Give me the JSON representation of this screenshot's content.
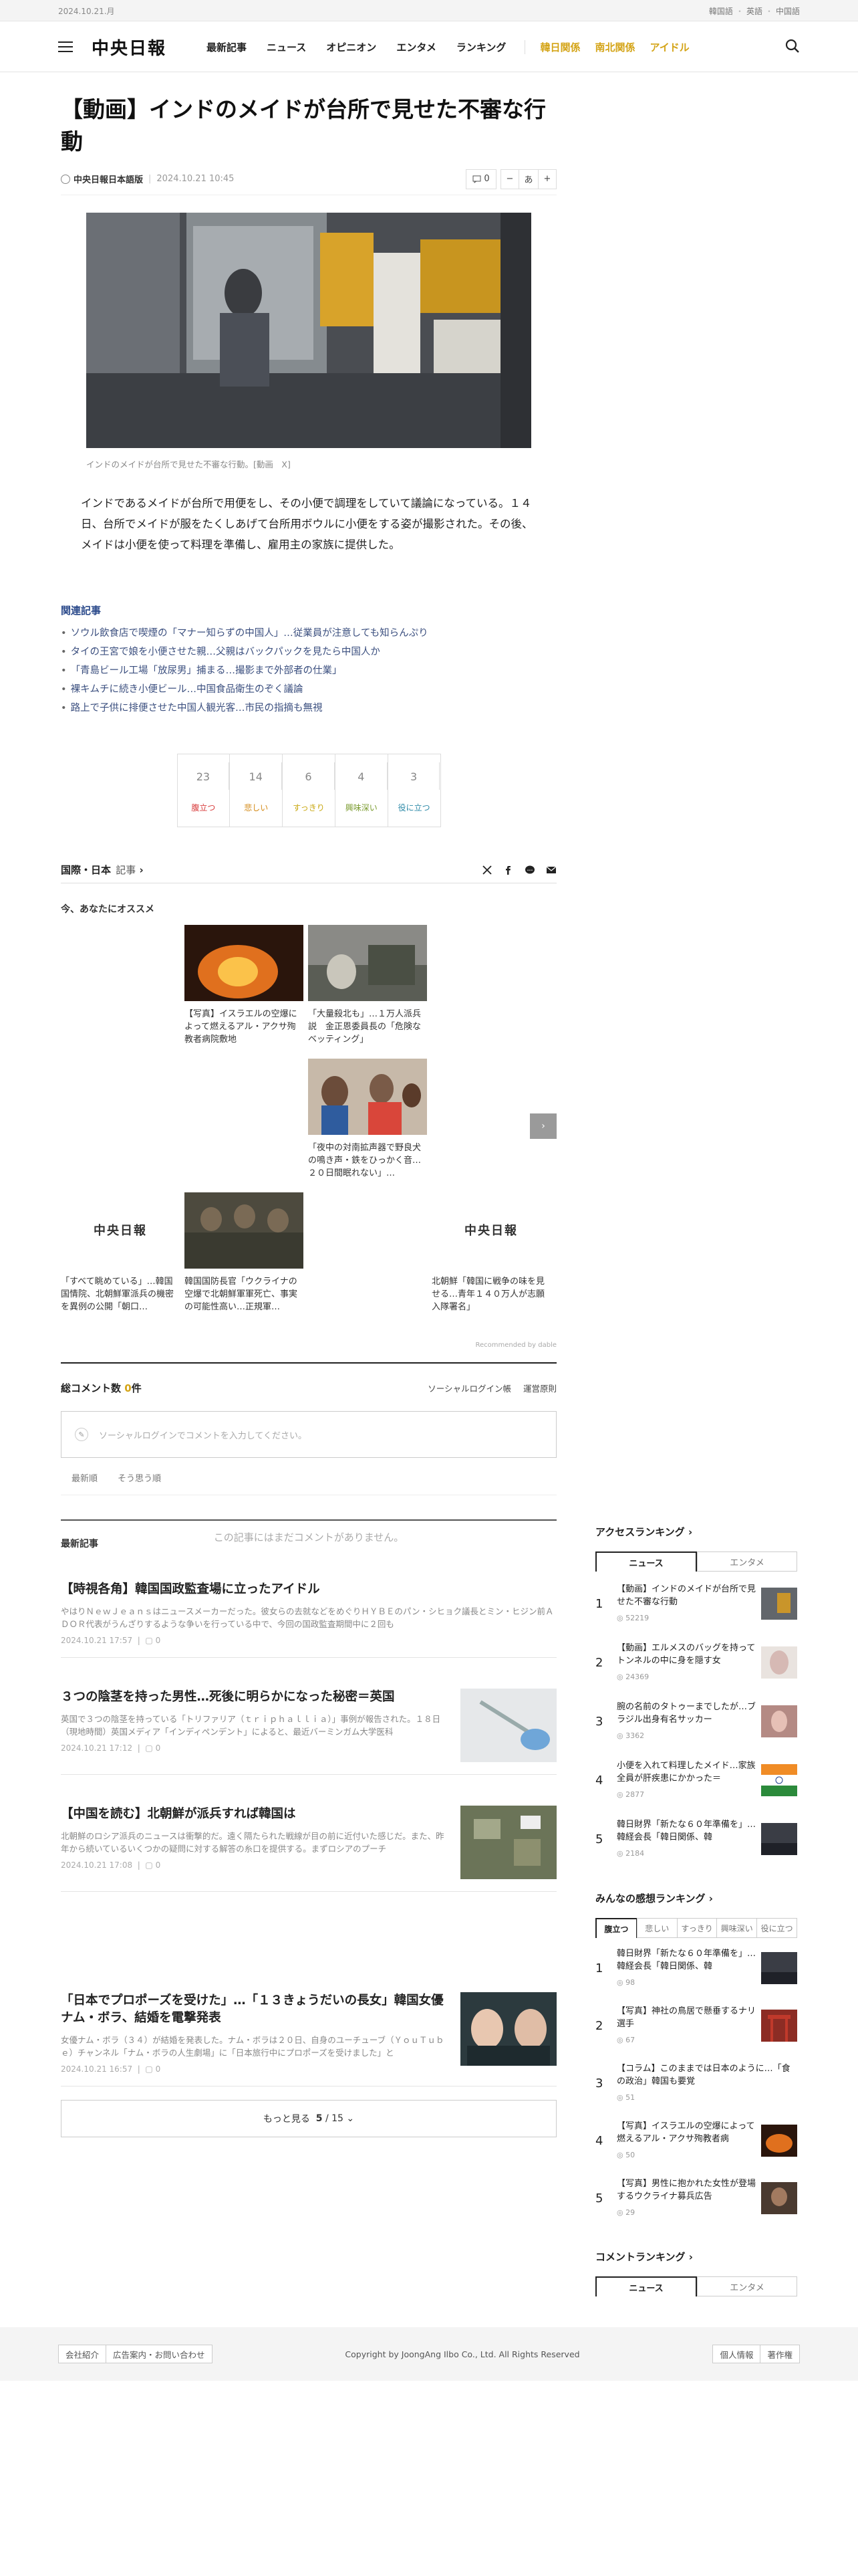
{
  "topbar": {
    "date": "2024.10.21.月",
    "languages": [
      "韓国語",
      "英語",
      "中国語"
    ]
  },
  "header": {
    "logo": "中央日報",
    "nav": [
      "最新記事",
      "ニュース",
      "オピニオン",
      "エンタメ",
      "ランキング"
    ],
    "subnav": [
      "韓日関係",
      "南北関係",
      "アイドル"
    ]
  },
  "article": {
    "title": "【動画】インドのメイドが台所で見せた不審な行動",
    "source": "中央日報日本語版",
    "datetime": "2024.10.21 10:45",
    "comment_count": "0",
    "font_label": "あ",
    "caption": "インドのメイドが台所で見せた不審な行動。[動画　X]",
    "body": "インドであるメイドが台所で用便をし、その小便で調理をしていて議論になっている。１４日、台所でメイドが服をたくしあげて台所用ボウルに小便をする姿が撮影された。その後、メイドは小便を使って料理を準備し、雇用主の家族に提供した。"
  },
  "related": {
    "heading": "関連記事",
    "items": [
      "ソウル飲食店で喫煙の「マナー知らずの中国人」…従業員が注意しても知らんぷり",
      "タイの王宮で娘を小便させた親…父親はバックパックを見たら中国人か",
      "「青島ビール工場「放尿男」捕まる…撮影まで外部者の仕業」",
      "裸キムチに続き小便ビール…中国食品衛生のぞく議論",
      "路上で子供に排便させた中国人観光客…市民の指摘も無視"
    ]
  },
  "reactions": [
    {
      "count": "23",
      "label": "腹立つ",
      "color": "#d83b3b"
    },
    {
      "count": "14",
      "label": "悲しい",
      "color": "#d48a17"
    },
    {
      "count": "6",
      "label": "すっきり",
      "color": "#d4b417"
    },
    {
      "count": "4",
      "label": "興味深い",
      "color": "#7a9b2e"
    },
    {
      "count": "3",
      "label": "役に立つ",
      "color": "#2e8aa8"
    }
  ],
  "section": {
    "name": "国際・日本",
    "suffix": "記事"
  },
  "recommend": {
    "heading": "今、あなたにオススメ",
    "items": [
      "【写真】イスラエルの空爆によって燃えるアル・アクサ殉教者病院敷地",
      "「大量殺北も」…１万人派兵説　金正恩委員長の「危険なベッティング」",
      "「夜中の対南拡声器で野良犬の鳴き声・鉄をひっかく音…２０日間眠れない」…",
      "「すべて眺めている」…韓国国情院、北朝鮮軍派兵の機密を異例の公開「朝口…",
      "韓国国防長官「ウクライナの空爆で北朝鮮軍軍死亡、事実の可能性高い…正規軍…",
      "北朝鮮「韓国に戦争の味を見せる…青年１４０万人が志願入隊署名」"
    ],
    "logo_text": "中央日報",
    "powered": "Recommended by dable"
  },
  "comments": {
    "label": "総コメント数",
    "count": "0",
    "unit": "件",
    "login": "ソーシャルログイン帳",
    "rules": "運営原則",
    "placeholder": "ソーシャルログインでコメントを入力してください。",
    "sort": [
      "最新順",
      "そう思う順"
    ],
    "empty": "この記事にはまだコメントがありません。"
  },
  "latest": {
    "heading": "最新記事",
    "items": [
      {
        "title": "【時視各角】韓国国政監査場に立ったアイドル",
        "summary": "やはりＮｅｗＪｅａｎｓはニュースメーカーだった。彼女らの去就などをめぐりＨＹＢＥのパン・シヒョク議長とミン・ヒジン前ＡＤＯＲ代表がうんざりするような争いを行っている中で、今回の国政監査期間中に２回も",
        "date": "2024.10.21 17:57",
        "comments": "0"
      },
      {
        "title": "３つの陰茎を持った男性…死後に明らかになった秘密＝英国",
        "summary": "英国で３つの陰茎を持っている「トリファリア（ｔｒｉｐｈａｌｌｉａ）」事例が報告された。１８日（現地時間）英国メディア「インディペンデント」によると、最近バーミンガム大学医科",
        "date": "2024.10.21 17:12",
        "comments": "0"
      },
      {
        "title": "【中国を読む】北朝鮮が派兵すれば韓国は",
        "summary": "北朝鮮のロシア派兵のニュースは衝撃的だ。遠く隔たられた戦線が目の前に近付いた感じだ。また、昨年から続いているいくつかの疑問に対する解答の糸口を提供する。まずロシアのプーチ",
        "date": "2024.10.21 17:08",
        "comments": "0"
      },
      {
        "title": "「日本でプロポーズを受けた」…「１３きょうだいの長女」韓国女優ナム・ボラ、結婚を電撃発表",
        "summary": "女優ナム・ボラ（３４）が結婚を発表した。ナム・ボラは２０日、自身のユーチューブ（ＹｏｕＴｕｂｅ）チャンネル「ナム・ボラの人生劇場」に「日本旅行中にプロポーズを受けました」と",
        "date": "2024.10.21 16:57",
        "comments": "0"
      }
    ],
    "more": "もっと見る",
    "page": "5",
    "pages": "15"
  },
  "sidebar": {
    "access_heading": "アクセスランキング",
    "access_tabs": [
      "ニュース",
      "エンタメ"
    ],
    "access": [
      {
        "title": "【動画】インドのメイドが台所で見せた不審な行動",
        "views": "52219"
      },
      {
        "title": "【動画】エルメスのバッグを持ってトンネルの中に身を隠す女",
        "views": "24369"
      },
      {
        "title": "腕の名前のタトゥーまでしたが…ブラジル出身有名サッカー",
        "views": "3362"
      },
      {
        "title": "小便を入れて料理したメイド…家族全員が肝疾患にかかった＝",
        "views": "2877"
      },
      {
        "title": "韓日財界「新たな６０年準備を」…韓経会長「韓日関係、韓",
        "views": "2184"
      }
    ],
    "emotion_heading": "みんなの感想ランキング",
    "emotion_tabs": [
      "腹立つ",
      "悲しい",
      "すっきり",
      "興味深い",
      "役に立つ"
    ],
    "emotion": [
      {
        "title": "韓日財界「新たな６０年準備を」…韓経会長「韓日関係、韓",
        "views": "98"
      },
      {
        "title": "【写真】神社の鳥居で懸垂するナリ選手",
        "views": "67"
      },
      {
        "title": "【コラム】このままでは日本のように…「食の政治」韓国も要覚",
        "views": "51"
      },
      {
        "title": "【写真】イスラエルの空爆によって燃えるアル・アクサ殉教者病",
        "views": "50"
      },
      {
        "title": "【写真】男性に抱かれた女性が登場するウクライナ募兵広告",
        "views": "29"
      }
    ],
    "comment_heading": "コメントランキング",
    "comment_tabs": [
      "ニュース",
      "エンタメ"
    ]
  },
  "footer": {
    "left": [
      "会社紹介",
      "広告案内・お問い合わせ"
    ],
    "copyright": "Copyright by JoongAng Ilbo Co., Ltd. All Rights Reserved",
    "right": [
      "個人情報",
      "著作権"
    ]
  }
}
